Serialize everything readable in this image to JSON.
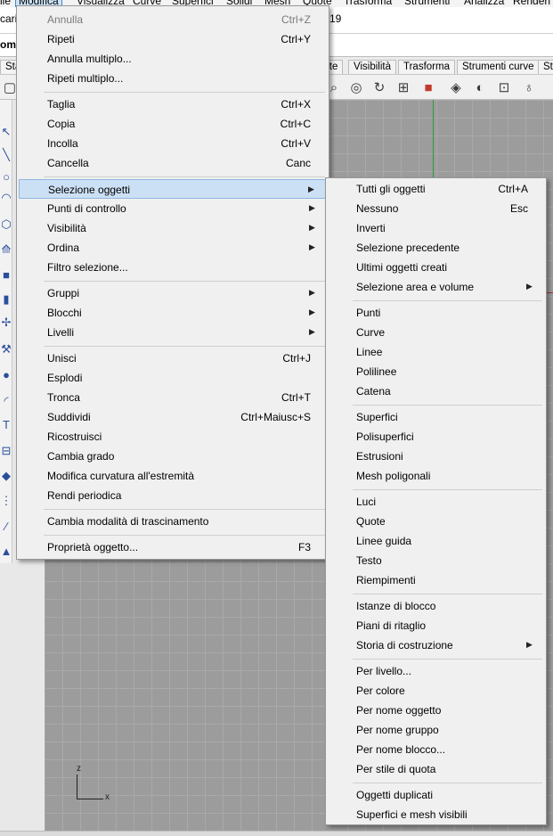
{
  "menubar": {
    "items": [
      {
        "label": "ile"
      },
      {
        "label": "Modifica"
      },
      {
        "label": "Visualizza"
      },
      {
        "label": "Curve"
      },
      {
        "label": "Superfici"
      },
      {
        "label": "Solidi"
      },
      {
        "label": "Mesh"
      },
      {
        "label": "Quote"
      },
      {
        "label": "Trasforma"
      },
      {
        "label": "Strumenti"
      },
      {
        "label": "Analizza"
      },
      {
        "label": "Renderi"
      }
    ]
  },
  "command": {
    "history_left": "cari",
    "history_right": "19",
    "prompt": "om"
  },
  "toolbar_tabs": [
    "Sta",
    "ste",
    "Visibilità",
    "Trasforma",
    "Strumenti curve",
    "St"
  ],
  "toolbar_icons": [
    "zoom-window-icon",
    "zoom-target-icon",
    "rotate-view-icon",
    "four-viewports-icon",
    "car-render-icon",
    "mesh-icon",
    "display-mode-icon",
    "point-icon",
    "light-bulb-icon"
  ],
  "left_tools": [
    "select-icon",
    "line-icon",
    "circle-icon",
    "arc-icon",
    "polygon-icon",
    "transform-icon",
    "box-icon",
    "cylinder-icon",
    "gumball-icon",
    "boolean-icon",
    "sphere-icon",
    "text-icon",
    "array-icon",
    "cube-icon",
    "grid-icon",
    "wand-icon",
    "cone-icon"
  ],
  "viewport": {
    "gizmo_z": "z",
    "gizmo_x": "x"
  },
  "main_menu": {
    "items": [
      {
        "label": "Annulla",
        "shortcut": "Ctrl+Z",
        "disabled": true
      },
      {
        "label": "Ripeti",
        "shortcut": "Ctrl+Y"
      },
      {
        "label": "Annulla multiplo...",
        "shortcut": ""
      },
      {
        "label": "Ripeti multiplo...",
        "shortcut": ""
      },
      {
        "label": "Taglia",
        "shortcut": "Ctrl+X"
      },
      {
        "label": "Copia",
        "shortcut": "Ctrl+C"
      },
      {
        "label": "Incolla",
        "shortcut": "Ctrl+V"
      },
      {
        "label": "Cancella",
        "shortcut": "Canc"
      },
      {
        "label": "Selezione oggetti",
        "submenu": true,
        "highlighted": true
      },
      {
        "label": "Punti di controllo",
        "submenu": true
      },
      {
        "label": "Visibilità",
        "submenu": true
      },
      {
        "label": "Ordina",
        "submenu": true
      },
      {
        "label": "Filtro selezione...",
        "shortcut": ""
      },
      {
        "label": "Gruppi",
        "submenu": true
      },
      {
        "label": "Blocchi",
        "submenu": true
      },
      {
        "label": "Livelli",
        "submenu": true
      },
      {
        "label": "Unisci",
        "shortcut": "Ctrl+J"
      },
      {
        "label": "Esplodi",
        "shortcut": ""
      },
      {
        "label": "Tronca",
        "shortcut": "Ctrl+T"
      },
      {
        "label": "Suddividi",
        "shortcut": "Ctrl+Maiusc+S"
      },
      {
        "label": "Ricostruisci",
        "shortcut": ""
      },
      {
        "label": "Cambia grado",
        "shortcut": ""
      },
      {
        "label": "Modifica curvatura all'estremità",
        "shortcut": ""
      },
      {
        "label": "Rendi periodica",
        "shortcut": ""
      },
      {
        "label": "Cambia modalità di trascinamento",
        "shortcut": ""
      },
      {
        "label": "Proprietà oggetto...",
        "shortcut": "F3"
      }
    ]
  },
  "sub_menu": {
    "items": [
      {
        "label": "Tutti gli oggetti",
        "shortcut": "Ctrl+A"
      },
      {
        "label": "Nessuno",
        "shortcut": "Esc"
      },
      {
        "label": "Inverti",
        "shortcut": ""
      },
      {
        "label": "Selezione precedente",
        "shortcut": ""
      },
      {
        "label": "Ultimi oggetti creati",
        "shortcut": ""
      },
      {
        "label": "Selezione area e volume",
        "submenu": true
      },
      {
        "label": "Punti",
        "shortcut": ""
      },
      {
        "label": "Curve",
        "shortcut": ""
      },
      {
        "label": "Linee",
        "shortcut": ""
      },
      {
        "label": "Polilinee",
        "shortcut": ""
      },
      {
        "label": "Catena",
        "shortcut": ""
      },
      {
        "label": "Superfici",
        "shortcut": ""
      },
      {
        "label": "Polisuperfici",
        "shortcut": ""
      },
      {
        "label": "Estrusioni",
        "shortcut": ""
      },
      {
        "label": "Mesh poligonali",
        "shortcut": ""
      },
      {
        "label": "Luci",
        "shortcut": ""
      },
      {
        "label": "Quote",
        "shortcut": ""
      },
      {
        "label": "Linee guida",
        "shortcut": ""
      },
      {
        "label": "Testo",
        "shortcut": ""
      },
      {
        "label": "Riempimenti",
        "shortcut": ""
      },
      {
        "label": "Istanze di blocco",
        "shortcut": ""
      },
      {
        "label": "Piani di ritaglio",
        "shortcut": ""
      },
      {
        "label": "Storia di costruzione",
        "submenu": true
      },
      {
        "label": "Per livello...",
        "shortcut": ""
      },
      {
        "label": "Per colore",
        "shortcut": ""
      },
      {
        "label": "Per nome oggetto",
        "shortcut": ""
      },
      {
        "label": "Per nome gruppo",
        "shortcut": ""
      },
      {
        "label": "Per nome blocco...",
        "shortcut": ""
      },
      {
        "label": "Per stile di quota",
        "shortcut": ""
      },
      {
        "label": "Oggetti duplicati",
        "shortcut": ""
      },
      {
        "label": "Superfici e mesh visibili",
        "shortcut": ""
      }
    ]
  },
  "glyphs": {
    "submenu_arrow": "▶"
  }
}
